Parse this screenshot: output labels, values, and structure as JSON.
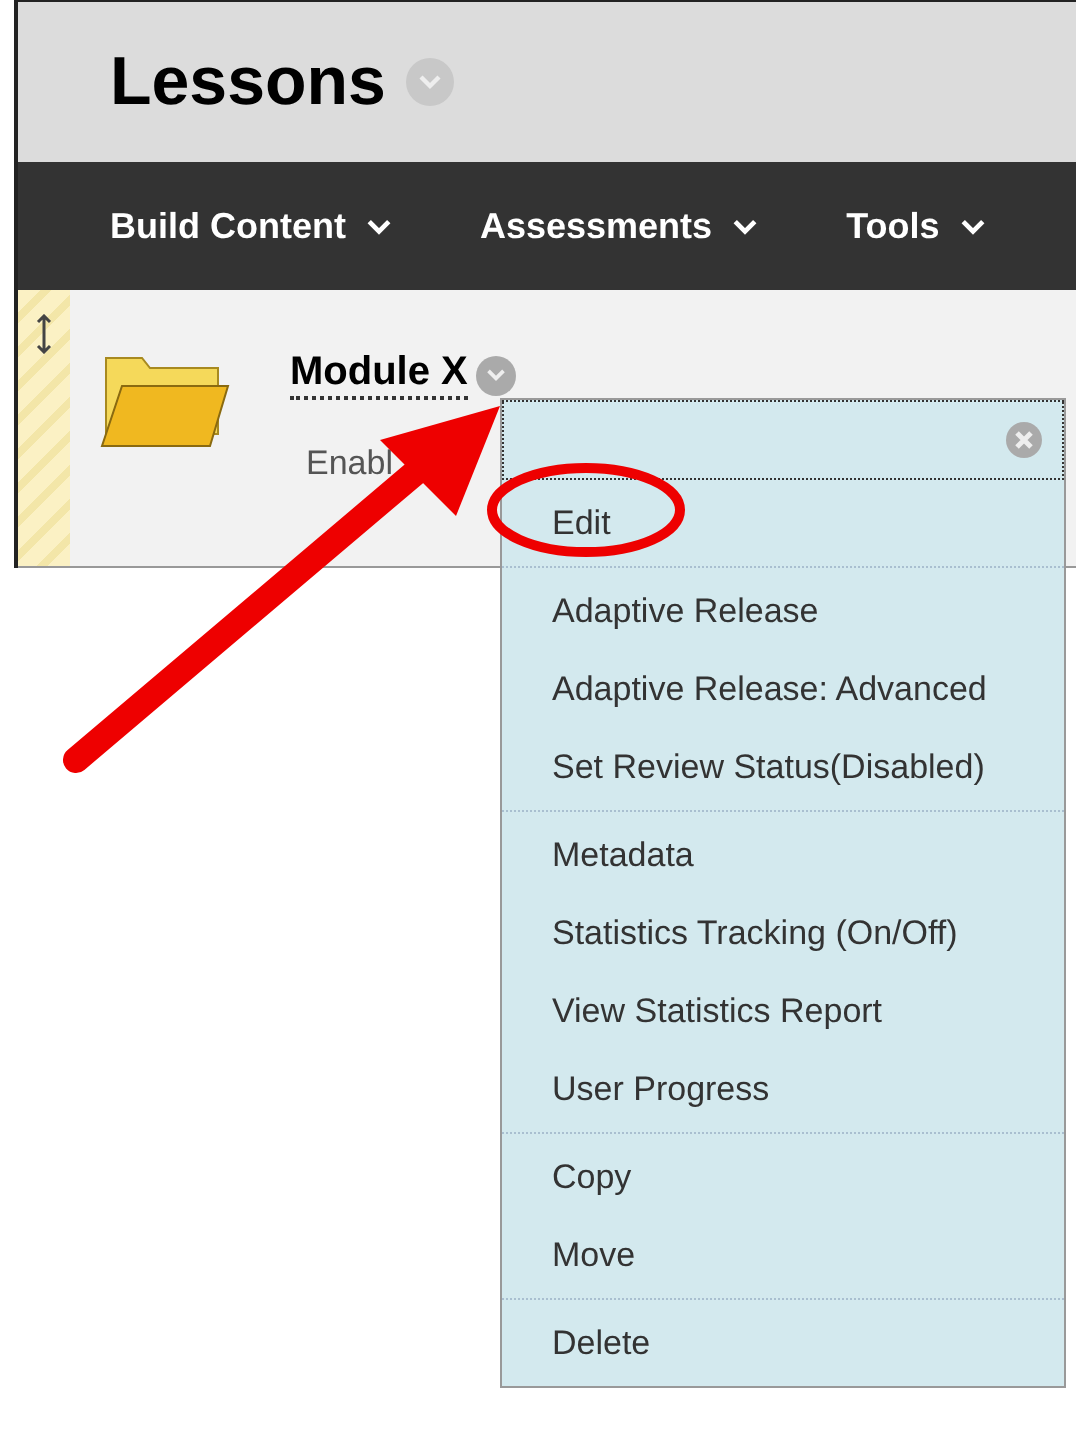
{
  "page": {
    "title": "Lessons"
  },
  "nav": [
    {
      "label": "Build Content"
    },
    {
      "label": "Assessments"
    },
    {
      "label": "Tools"
    }
  ],
  "item": {
    "title": "Module X",
    "status": "Enabl"
  },
  "context_menu": {
    "groups": [
      {
        "items": [
          "Edit"
        ]
      },
      {
        "items": [
          "Adaptive Release",
          "Adaptive Release: Advanced",
          "Set Review Status(Disabled)"
        ]
      },
      {
        "items": [
          "Metadata",
          "Statistics Tracking (On/Off)",
          "View Statistics Report",
          "User Progress"
        ]
      },
      {
        "items": [
          "Copy",
          "Move"
        ]
      },
      {
        "items": [
          "Delete"
        ]
      }
    ]
  }
}
